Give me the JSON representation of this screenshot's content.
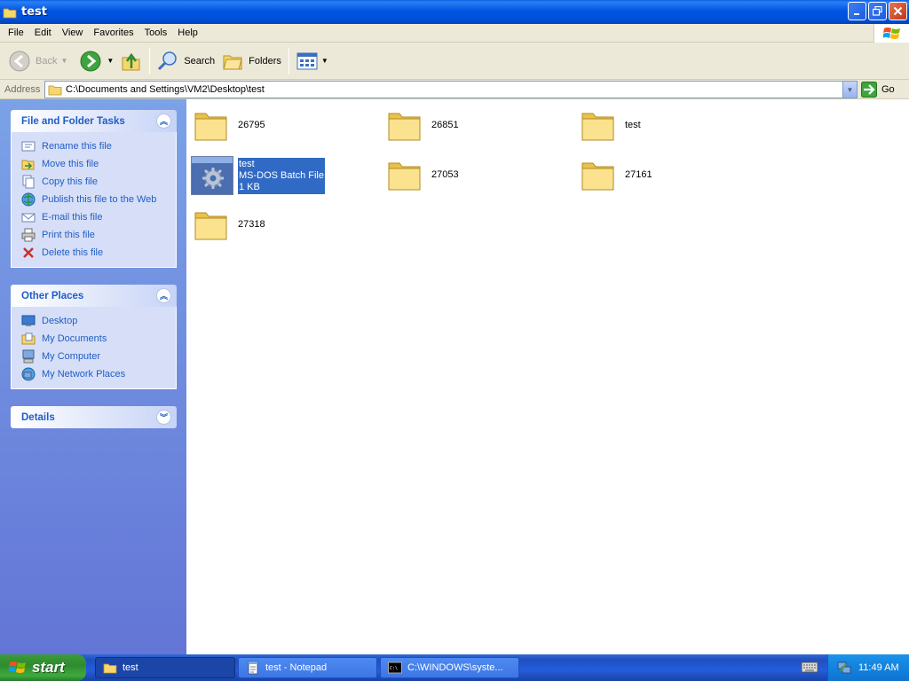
{
  "window": {
    "title": "test"
  },
  "menu": [
    "File",
    "Edit",
    "View",
    "Favorites",
    "Tools",
    "Help"
  ],
  "toolbar": {
    "back_label": "Back",
    "search_label": "Search",
    "folders_label": "Folders"
  },
  "address": {
    "label": "Address",
    "value": "C:\\Documents and Settings\\VM2\\Desktop\\test",
    "go_label": "Go"
  },
  "panels": {
    "tasks": {
      "title": "File and Folder Tasks",
      "items": [
        {
          "label": "Rename this file",
          "icon": "rename-icon"
        },
        {
          "label": "Move this file",
          "icon": "move-icon"
        },
        {
          "label": "Copy this file",
          "icon": "copy-icon"
        },
        {
          "label": "Publish this file to the Web",
          "icon": "publish-icon"
        },
        {
          "label": "E-mail this file",
          "icon": "email-icon"
        },
        {
          "label": "Print this file",
          "icon": "print-icon"
        },
        {
          "label": "Delete this file",
          "icon": "delete-icon"
        }
      ]
    },
    "places": {
      "title": "Other Places",
      "items": [
        {
          "label": "Desktop",
          "icon": "desktop-icon"
        },
        {
          "label": "My Documents",
          "icon": "my-documents-icon"
        },
        {
          "label": "My Computer",
          "icon": "my-computer-icon"
        },
        {
          "label": "My Network Places",
          "icon": "network-places-icon"
        }
      ]
    },
    "details": {
      "title": "Details"
    }
  },
  "files": [
    {
      "name": "26795",
      "type": "folder"
    },
    {
      "name": "26851",
      "type": "folder"
    },
    {
      "name": "test",
      "type": "folder"
    },
    {
      "name": "test",
      "type": "batch",
      "kind": "MS-DOS Batch File",
      "size": "1 KB",
      "selected": true
    },
    {
      "name": "27053",
      "type": "folder"
    },
    {
      "name": "27161",
      "type": "folder"
    },
    {
      "name": "27318",
      "type": "folder"
    }
  ],
  "taskbar": {
    "start_label": "start",
    "tasks": [
      {
        "label": "test",
        "active": true
      },
      {
        "label": "test - Notepad",
        "active": false
      },
      {
        "label": "C:\\WINDOWS\\syste...",
        "active": false
      }
    ],
    "clock": "11:49 AM"
  },
  "colors": {
    "titlebar": "#0054e3",
    "selection": "#316ac5",
    "link": "#215dc6"
  }
}
